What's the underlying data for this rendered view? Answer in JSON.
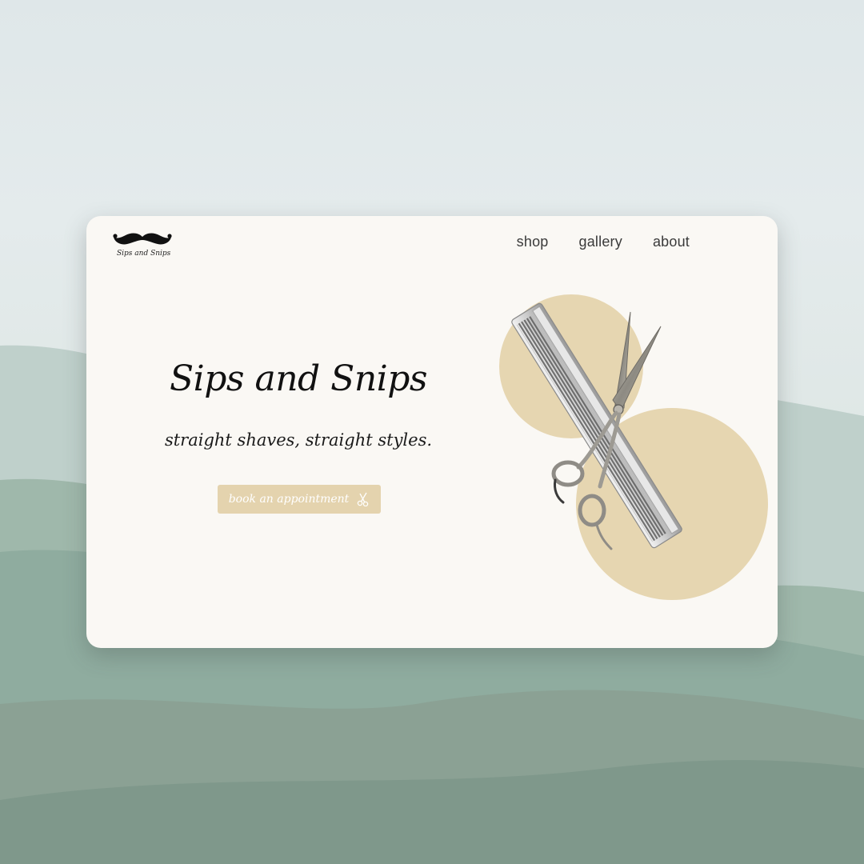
{
  "brand": {
    "logo_text": "Sips and Snips",
    "logo_icon": "mustache-icon"
  },
  "nav": {
    "items": [
      {
        "label": "shop"
      },
      {
        "label": "gallery"
      },
      {
        "label": "about"
      }
    ]
  },
  "hero": {
    "title": "Sips and Snips",
    "subtitle": "straight shaves, straight styles.",
    "cta_label": "book an appointment",
    "cta_icon": "scissors-icon"
  },
  "illustration": {
    "icons": [
      "comb-icon",
      "scissors-icon"
    ]
  },
  "colors": {
    "card_background": "#faf8f4",
    "accent": "#e4d3ae",
    "accent_circle": "#e6d6b1",
    "backdrop_sky": "#e0e8ea",
    "backdrop_hills": "#8fa89c"
  }
}
